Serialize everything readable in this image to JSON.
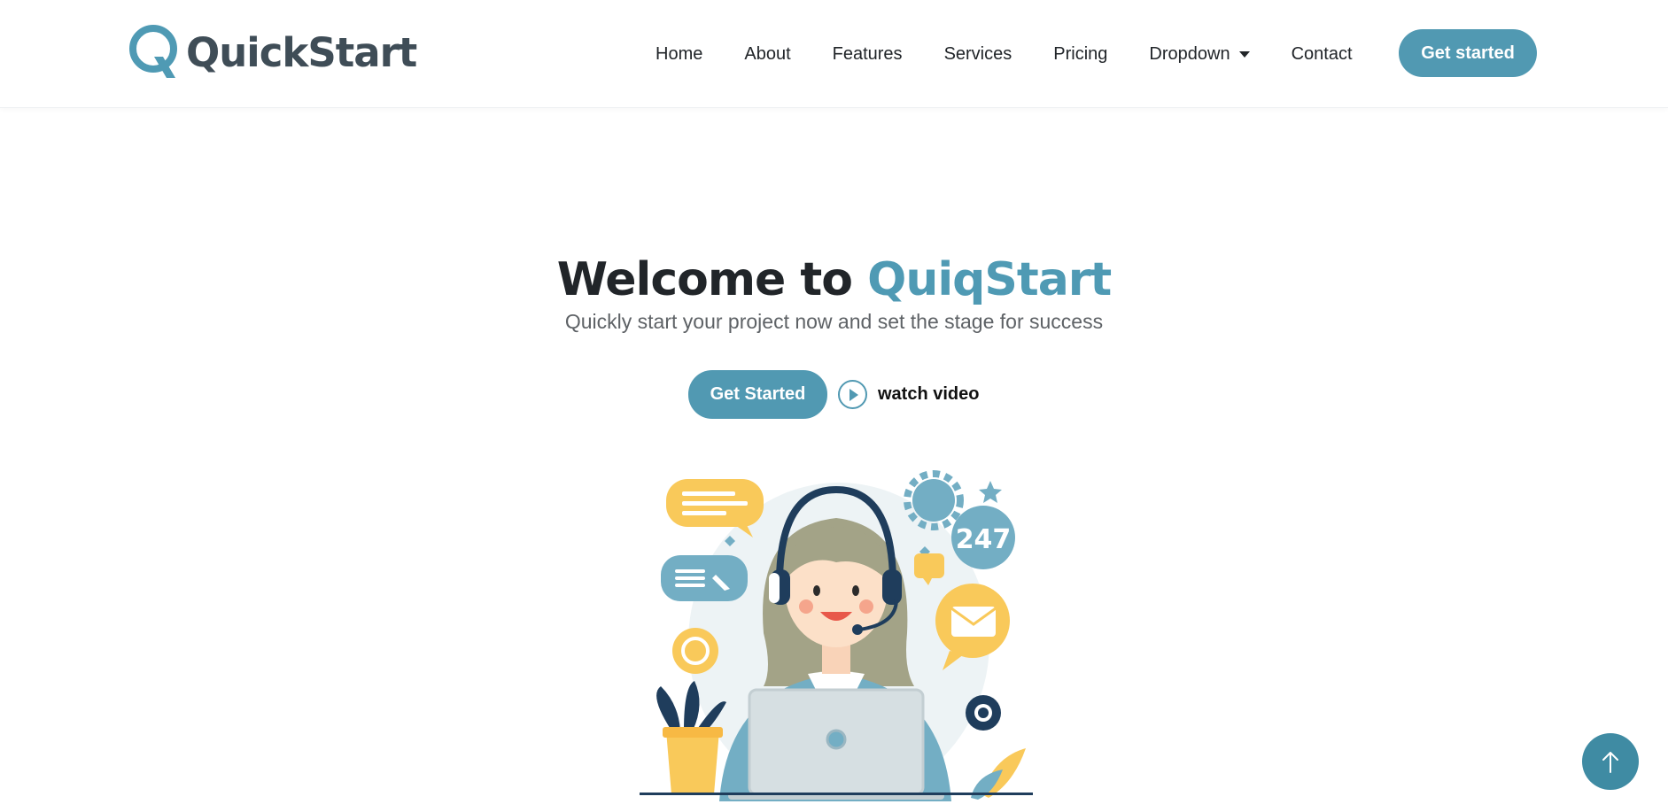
{
  "header": {
    "logo_text": "QuickStart",
    "nav": [
      {
        "label": "Home"
      },
      {
        "label": "About"
      },
      {
        "label": "Features"
      },
      {
        "label": "Services"
      },
      {
        "label": "Pricing"
      },
      {
        "label": "Dropdown"
      },
      {
        "label": "Contact"
      }
    ],
    "cta_label": "Get started"
  },
  "hero": {
    "title_prefix": "Welcome to ",
    "title_accent": "QuiqStart",
    "subtitle": "Quickly start your project now and set the stage for success",
    "primary_button": "Get Started",
    "video_link": "watch video",
    "illustration_badge": "247"
  },
  "icons": {
    "dropdown": "caret-down-icon",
    "video": "play-circle-icon",
    "scroll": "arrow-up-icon"
  },
  "colors": {
    "accent": "#5199b2",
    "text": "#212529",
    "muted": "#5e6266"
  }
}
